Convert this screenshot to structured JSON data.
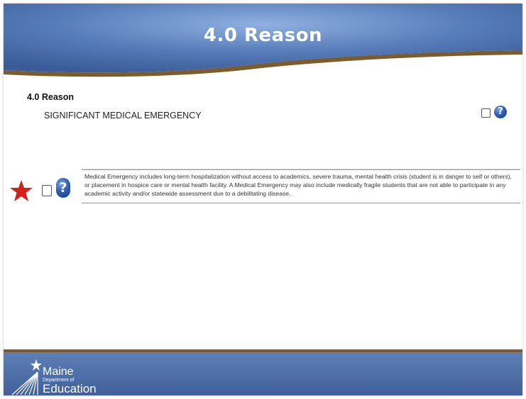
{
  "header": {
    "title": "4.0 Reason"
  },
  "section": {
    "label": "4.0 Reason",
    "value": "SIGNIFICANT MEDICAL EMERGENCY",
    "checkbox_checked": false
  },
  "definition": {
    "text": "Medical Emergency  includes long-term hospitalization without access to academics, severe trauma, mental health crisis (student is in danger to self or others), or placement in hospice care or mental health facility. A Medical Emergency may also include medically fragile students that are not able to participate in any academic activity and/or statewide assessment due to a debilitating disease.",
    "checkbox_checked": false
  },
  "help": {
    "glyph": "?"
  },
  "footer": {
    "logo_line1": "Maine",
    "logo_line2": "Department of",
    "logo_line3": "Education"
  },
  "colors": {
    "header_blue": "#4f72ad",
    "gold": "#7a5c2e",
    "star_red": "#d0211c",
    "help_blue": "#2f5fb5"
  }
}
